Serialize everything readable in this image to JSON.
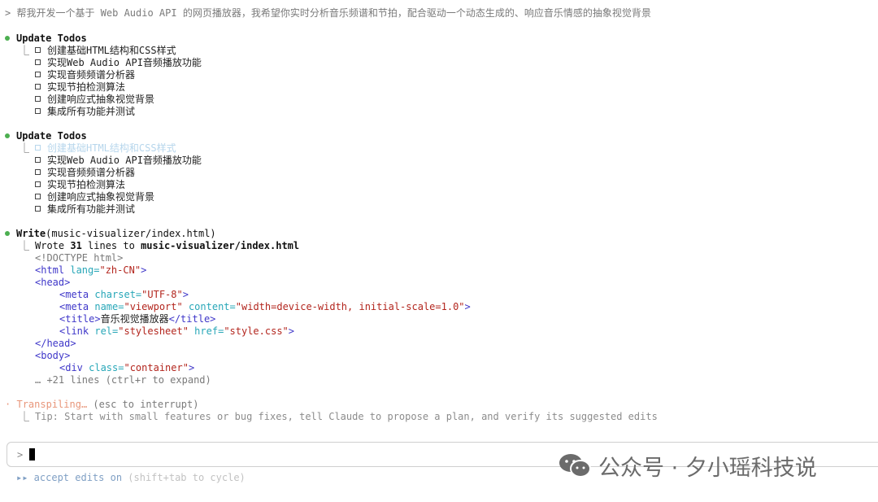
{
  "user_prompt": "> 帮我开发一个基于 Web Audio API 的网页播放器，我希望你实时分析音乐频谱和节拍，配合驱动一个动态生成的、响应音乐情感的抽象视觉背景",
  "todos_1": {
    "header": "Update Todos",
    "items": [
      "创建基础HTML结构和CSS样式",
      "实现Web Audio API音频播放功能",
      "实现音频频谱分析器",
      "实现节拍检测算法",
      "创建响应式抽象视觉背景",
      "集成所有功能并测试"
    ]
  },
  "todos_2": {
    "header": "Update Todos",
    "items": [
      "创建基础HTML结构和CSS样式",
      "实现Web Audio API音频播放功能",
      "实现音频频谱分析器",
      "实现节拍检测算法",
      "创建响应式抽象视觉背景",
      "集成所有功能并测试"
    ]
  },
  "write": {
    "tool": "Write",
    "args": "(music-visualizer/index.html)",
    "result_prefix": "Wrote ",
    "line_count": "31",
    "result_mid": " lines to ",
    "result_path": "music-visualizer/index.html",
    "code": {
      "doctype": "<!DOCTYPE html>",
      "html_open": "<html",
      "lang_attr": " lang=",
      "lang_val": "\"zh-CN\"",
      "gt": ">",
      "head_open": "<head>",
      "meta1_open": "<meta",
      "charset_attr": " charset=",
      "charset_val": "\"UTF-8\"",
      "meta2_open": "<meta",
      "name_attr": " name=",
      "name_val": "\"viewport\"",
      "content_attr": " content=",
      "content_val": "\"width=device-width, initial-scale=1.0\"",
      "title_open": "<title>",
      "title_text": "音乐视觉播放器",
      "title_close": "</title>",
      "link_open": "<link",
      "rel_attr": " rel=",
      "rel_val": "\"stylesheet\"",
      "href_attr": " href=",
      "href_val": "\"style.css\"",
      "head_close": "</head>",
      "body_open": "<body>",
      "div_open": "<div",
      "class_attr": " class=",
      "class_val": "\"container\"",
      "more": "… +21 lines (ctrl+r to expand)"
    }
  },
  "status": {
    "spinner": "·",
    "label": "Transpiling…",
    "hint": " (esc to interrupt)",
    "tip": "Tip: Start with small features or bug fixes, tell Claude to propose a plan, and verify its suggested edits"
  },
  "input": {
    "prompt": ">"
  },
  "footer": {
    "arrows": "▸▸",
    "mode": " accept edits on",
    "hint": " (shift+tab to cycle)"
  },
  "watermark": {
    "text": "公众号 · 夕小瑶科技说"
  },
  "colors": {
    "accent_dot": "#4caf50",
    "tag": "#3f37c9",
    "attr": "#28a7b8",
    "value": "#b3261e",
    "spinner": "#e8967a",
    "footer": "#7f9fc4"
  }
}
